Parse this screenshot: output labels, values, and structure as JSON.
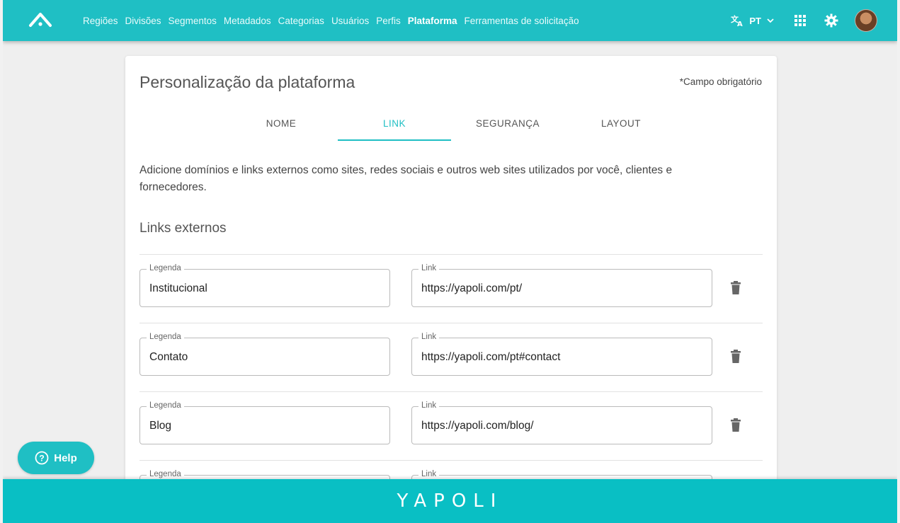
{
  "nav": {
    "items": [
      {
        "label": "Regiões",
        "active": false
      },
      {
        "label": "Divisões",
        "active": false
      },
      {
        "label": "Segmentos",
        "active": false
      },
      {
        "label": "Metadados",
        "active": false
      },
      {
        "label": "Categorias",
        "active": false
      },
      {
        "label": "Usuários",
        "active": false
      },
      {
        "label": "Perfis",
        "active": false
      },
      {
        "label": "Plataforma",
        "active": true
      },
      {
        "label": "Ferramentas de solicitação",
        "active": false
      }
    ],
    "language": "PT",
    "icons": [
      "translate-icon",
      "apps-grid-icon",
      "gear-icon",
      "avatar"
    ]
  },
  "card": {
    "title": "Personalização da plataforma",
    "required_note": "*Campo obrigatório",
    "tabs": [
      {
        "label": "NOME",
        "active": false
      },
      {
        "label": "LINK",
        "active": true
      },
      {
        "label": "SEGURANÇA",
        "active": false
      },
      {
        "label": "LAYOUT",
        "active": false
      }
    ],
    "description": "Adicione domínios e links externos como sites, redes sociais e outros web sites utilizados por você, clientes e fornecedores.",
    "section_title": "Links externos",
    "links": [
      {
        "legend_label": "Legenda",
        "legend_value": "Institucional",
        "link_label": "Link",
        "link_value": "https://yapoli.com/pt/"
      },
      {
        "legend_label": "Legenda",
        "legend_value": "Contato",
        "link_label": "Link",
        "link_value": "https://yapoli.com/pt#contact"
      },
      {
        "legend_label": "Legenda",
        "legend_value": "Blog",
        "link_label": "Link",
        "link_value": "https://yapoli.com/blog/"
      },
      {
        "legend_label": "Legenda",
        "legend_value": "",
        "link_label": "Link",
        "link_value": ""
      }
    ]
  },
  "help": {
    "label": "Help"
  },
  "footer": {
    "brand": "YAPOLI"
  },
  "colors": {
    "accent": "#1fbfc4",
    "footer": "#09bfc4"
  }
}
